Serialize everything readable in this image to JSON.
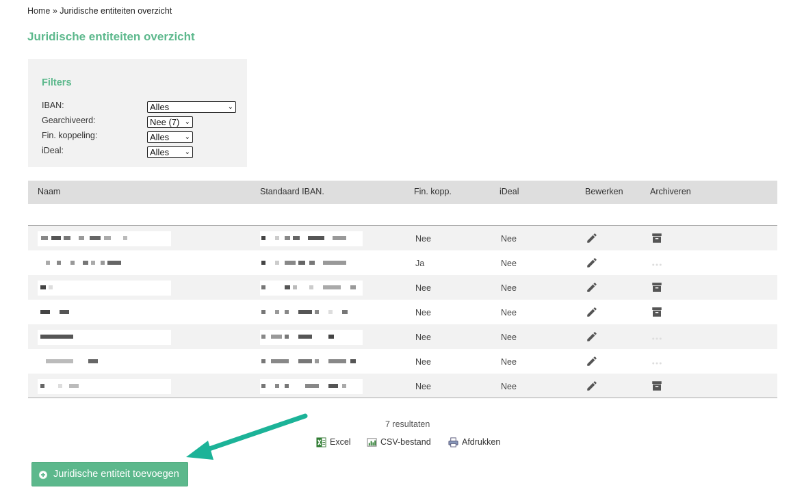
{
  "breadcrumb": {
    "home": "Home",
    "separator": "»",
    "current": "Juridische entiteiten overzicht"
  },
  "page_title": "Juridische entiteiten overzicht",
  "filters": {
    "title": "Filters",
    "iban": {
      "label": "IBAN:",
      "value": "Alles"
    },
    "gearchiveerd": {
      "label": "Gearchiveerd:",
      "value": "Nee (7)"
    },
    "fin_koppeling": {
      "label": "Fin. koppeling:",
      "value": "Alles"
    },
    "ideal": {
      "label": "iDeal:",
      "value": "Alles"
    }
  },
  "table": {
    "columns": [
      "Naam",
      "Standaard IBAN.",
      "Fin. kopp.",
      "iDeal",
      "Bewerken",
      "Archiveren"
    ],
    "rows": [
      {
        "fin": "Nee",
        "ideal": "Nee",
        "archive": "archive-icon"
      },
      {
        "fin": "Ja",
        "ideal": "Nee",
        "archive": "disabled-dots"
      },
      {
        "fin": "Nee",
        "ideal": "Nee",
        "archive": "archive-icon"
      },
      {
        "fin": "Nee",
        "ideal": "Nee",
        "archive": "archive-icon"
      },
      {
        "fin": "Nee",
        "ideal": "Nee",
        "archive": "disabled-dots"
      },
      {
        "fin": "Nee",
        "ideal": "Nee",
        "archive": "disabled-dots"
      },
      {
        "fin": "Nee",
        "ideal": "Nee",
        "archive": "archive-icon"
      }
    ]
  },
  "results": "7 resultaten",
  "exports": {
    "excel": "Excel",
    "csv": "CSV-bestand",
    "print": "Afdrukken"
  },
  "add_button": "Juridische entiteit toevoegen",
  "colors": {
    "accent": "#5cb88c",
    "arrow": "#1cb398",
    "header_bg": "#dedede",
    "alt_row": "#f2f2f2"
  },
  "icons": {
    "edit": "pencil-icon",
    "archive": "archive-box-icon",
    "excel": "excel-icon",
    "csv": "csv-icon",
    "print": "printer-icon",
    "add": "plus-circle-icon"
  }
}
